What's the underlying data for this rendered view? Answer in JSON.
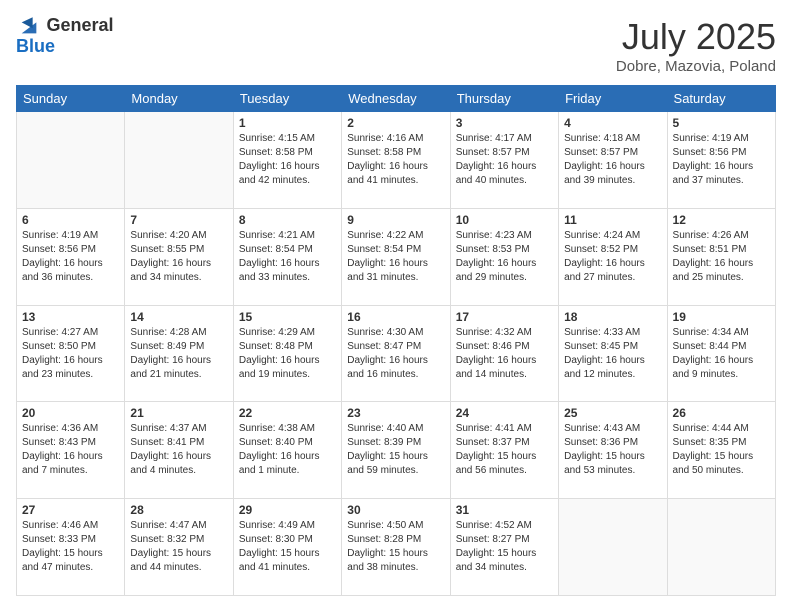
{
  "header": {
    "logo_line1": "General",
    "logo_line2": "Blue",
    "month_year": "July 2025",
    "location": "Dobre, Mazovia, Poland"
  },
  "weekdays": [
    "Sunday",
    "Monday",
    "Tuesday",
    "Wednesday",
    "Thursday",
    "Friday",
    "Saturday"
  ],
  "weeks": [
    [
      {
        "day": "",
        "info": ""
      },
      {
        "day": "",
        "info": ""
      },
      {
        "day": "1",
        "info": "Sunrise: 4:15 AM\nSunset: 8:58 PM\nDaylight: 16 hours\nand 42 minutes."
      },
      {
        "day": "2",
        "info": "Sunrise: 4:16 AM\nSunset: 8:58 PM\nDaylight: 16 hours\nand 41 minutes."
      },
      {
        "day": "3",
        "info": "Sunrise: 4:17 AM\nSunset: 8:57 PM\nDaylight: 16 hours\nand 40 minutes."
      },
      {
        "day": "4",
        "info": "Sunrise: 4:18 AM\nSunset: 8:57 PM\nDaylight: 16 hours\nand 39 minutes."
      },
      {
        "day": "5",
        "info": "Sunrise: 4:19 AM\nSunset: 8:56 PM\nDaylight: 16 hours\nand 37 minutes."
      }
    ],
    [
      {
        "day": "6",
        "info": "Sunrise: 4:19 AM\nSunset: 8:56 PM\nDaylight: 16 hours\nand 36 minutes."
      },
      {
        "day": "7",
        "info": "Sunrise: 4:20 AM\nSunset: 8:55 PM\nDaylight: 16 hours\nand 34 minutes."
      },
      {
        "day": "8",
        "info": "Sunrise: 4:21 AM\nSunset: 8:54 PM\nDaylight: 16 hours\nand 33 minutes."
      },
      {
        "day": "9",
        "info": "Sunrise: 4:22 AM\nSunset: 8:54 PM\nDaylight: 16 hours\nand 31 minutes."
      },
      {
        "day": "10",
        "info": "Sunrise: 4:23 AM\nSunset: 8:53 PM\nDaylight: 16 hours\nand 29 minutes."
      },
      {
        "day": "11",
        "info": "Sunrise: 4:24 AM\nSunset: 8:52 PM\nDaylight: 16 hours\nand 27 minutes."
      },
      {
        "day": "12",
        "info": "Sunrise: 4:26 AM\nSunset: 8:51 PM\nDaylight: 16 hours\nand 25 minutes."
      }
    ],
    [
      {
        "day": "13",
        "info": "Sunrise: 4:27 AM\nSunset: 8:50 PM\nDaylight: 16 hours\nand 23 minutes."
      },
      {
        "day": "14",
        "info": "Sunrise: 4:28 AM\nSunset: 8:49 PM\nDaylight: 16 hours\nand 21 minutes."
      },
      {
        "day": "15",
        "info": "Sunrise: 4:29 AM\nSunset: 8:48 PM\nDaylight: 16 hours\nand 19 minutes."
      },
      {
        "day": "16",
        "info": "Sunrise: 4:30 AM\nSunset: 8:47 PM\nDaylight: 16 hours\nand 16 minutes."
      },
      {
        "day": "17",
        "info": "Sunrise: 4:32 AM\nSunset: 8:46 PM\nDaylight: 16 hours\nand 14 minutes."
      },
      {
        "day": "18",
        "info": "Sunrise: 4:33 AM\nSunset: 8:45 PM\nDaylight: 16 hours\nand 12 minutes."
      },
      {
        "day": "19",
        "info": "Sunrise: 4:34 AM\nSunset: 8:44 PM\nDaylight: 16 hours\nand 9 minutes."
      }
    ],
    [
      {
        "day": "20",
        "info": "Sunrise: 4:36 AM\nSunset: 8:43 PM\nDaylight: 16 hours\nand 7 minutes."
      },
      {
        "day": "21",
        "info": "Sunrise: 4:37 AM\nSunset: 8:41 PM\nDaylight: 16 hours\nand 4 minutes."
      },
      {
        "day": "22",
        "info": "Sunrise: 4:38 AM\nSunset: 8:40 PM\nDaylight: 16 hours\nand 1 minute."
      },
      {
        "day": "23",
        "info": "Sunrise: 4:40 AM\nSunset: 8:39 PM\nDaylight: 15 hours\nand 59 minutes."
      },
      {
        "day": "24",
        "info": "Sunrise: 4:41 AM\nSunset: 8:37 PM\nDaylight: 15 hours\nand 56 minutes."
      },
      {
        "day": "25",
        "info": "Sunrise: 4:43 AM\nSunset: 8:36 PM\nDaylight: 15 hours\nand 53 minutes."
      },
      {
        "day": "26",
        "info": "Sunrise: 4:44 AM\nSunset: 8:35 PM\nDaylight: 15 hours\nand 50 minutes."
      }
    ],
    [
      {
        "day": "27",
        "info": "Sunrise: 4:46 AM\nSunset: 8:33 PM\nDaylight: 15 hours\nand 47 minutes."
      },
      {
        "day": "28",
        "info": "Sunrise: 4:47 AM\nSunset: 8:32 PM\nDaylight: 15 hours\nand 44 minutes."
      },
      {
        "day": "29",
        "info": "Sunrise: 4:49 AM\nSunset: 8:30 PM\nDaylight: 15 hours\nand 41 minutes."
      },
      {
        "day": "30",
        "info": "Sunrise: 4:50 AM\nSunset: 8:28 PM\nDaylight: 15 hours\nand 38 minutes."
      },
      {
        "day": "31",
        "info": "Sunrise: 4:52 AM\nSunset: 8:27 PM\nDaylight: 15 hours\nand 34 minutes."
      },
      {
        "day": "",
        "info": ""
      },
      {
        "day": "",
        "info": ""
      }
    ]
  ]
}
